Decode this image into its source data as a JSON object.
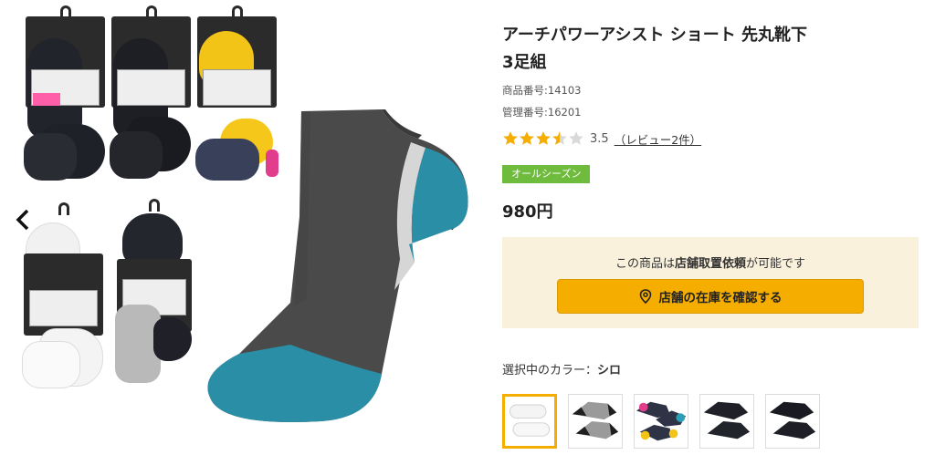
{
  "product": {
    "title_line1": "アーチパワーアシスト ショート 先丸靴下",
    "title_line2": "3足組",
    "item_number": "商品番号:14103",
    "control_number": "管理番号:16201",
    "rating_value": 3.5,
    "rating_text": "3.5",
    "review_text": "（レビュー2件）",
    "season_badge": "オールシーズン",
    "price": "980円"
  },
  "store": {
    "message_prefix": "この商品は",
    "message_bold": "店舗取置依頼",
    "message_suffix": "が可能です",
    "button_label": "店舗の在庫を確認する",
    "button_icon": "map-pin-icon"
  },
  "color_selector": {
    "label_prefix": "選択中のカラー：",
    "selected_color": "シロ",
    "swatches": [
      {
        "name": "white",
        "selected": true
      },
      {
        "name": "gray",
        "selected": false
      },
      {
        "name": "multi",
        "selected": false
      },
      {
        "name": "black-1",
        "selected": false
      },
      {
        "name": "black-2",
        "selected": false
      }
    ]
  },
  "gallery": {
    "prev_icon": "chevron-left-icon",
    "next_icon": "chevron-right-icon"
  },
  "colors": {
    "accent": "#f5ae00",
    "badge_green": "#6fbb3d",
    "store_bg": "#faf1dc",
    "star": "#f5ae00",
    "sock_gray": "#4a4a4a",
    "sock_teal": "#2a8fa6"
  }
}
